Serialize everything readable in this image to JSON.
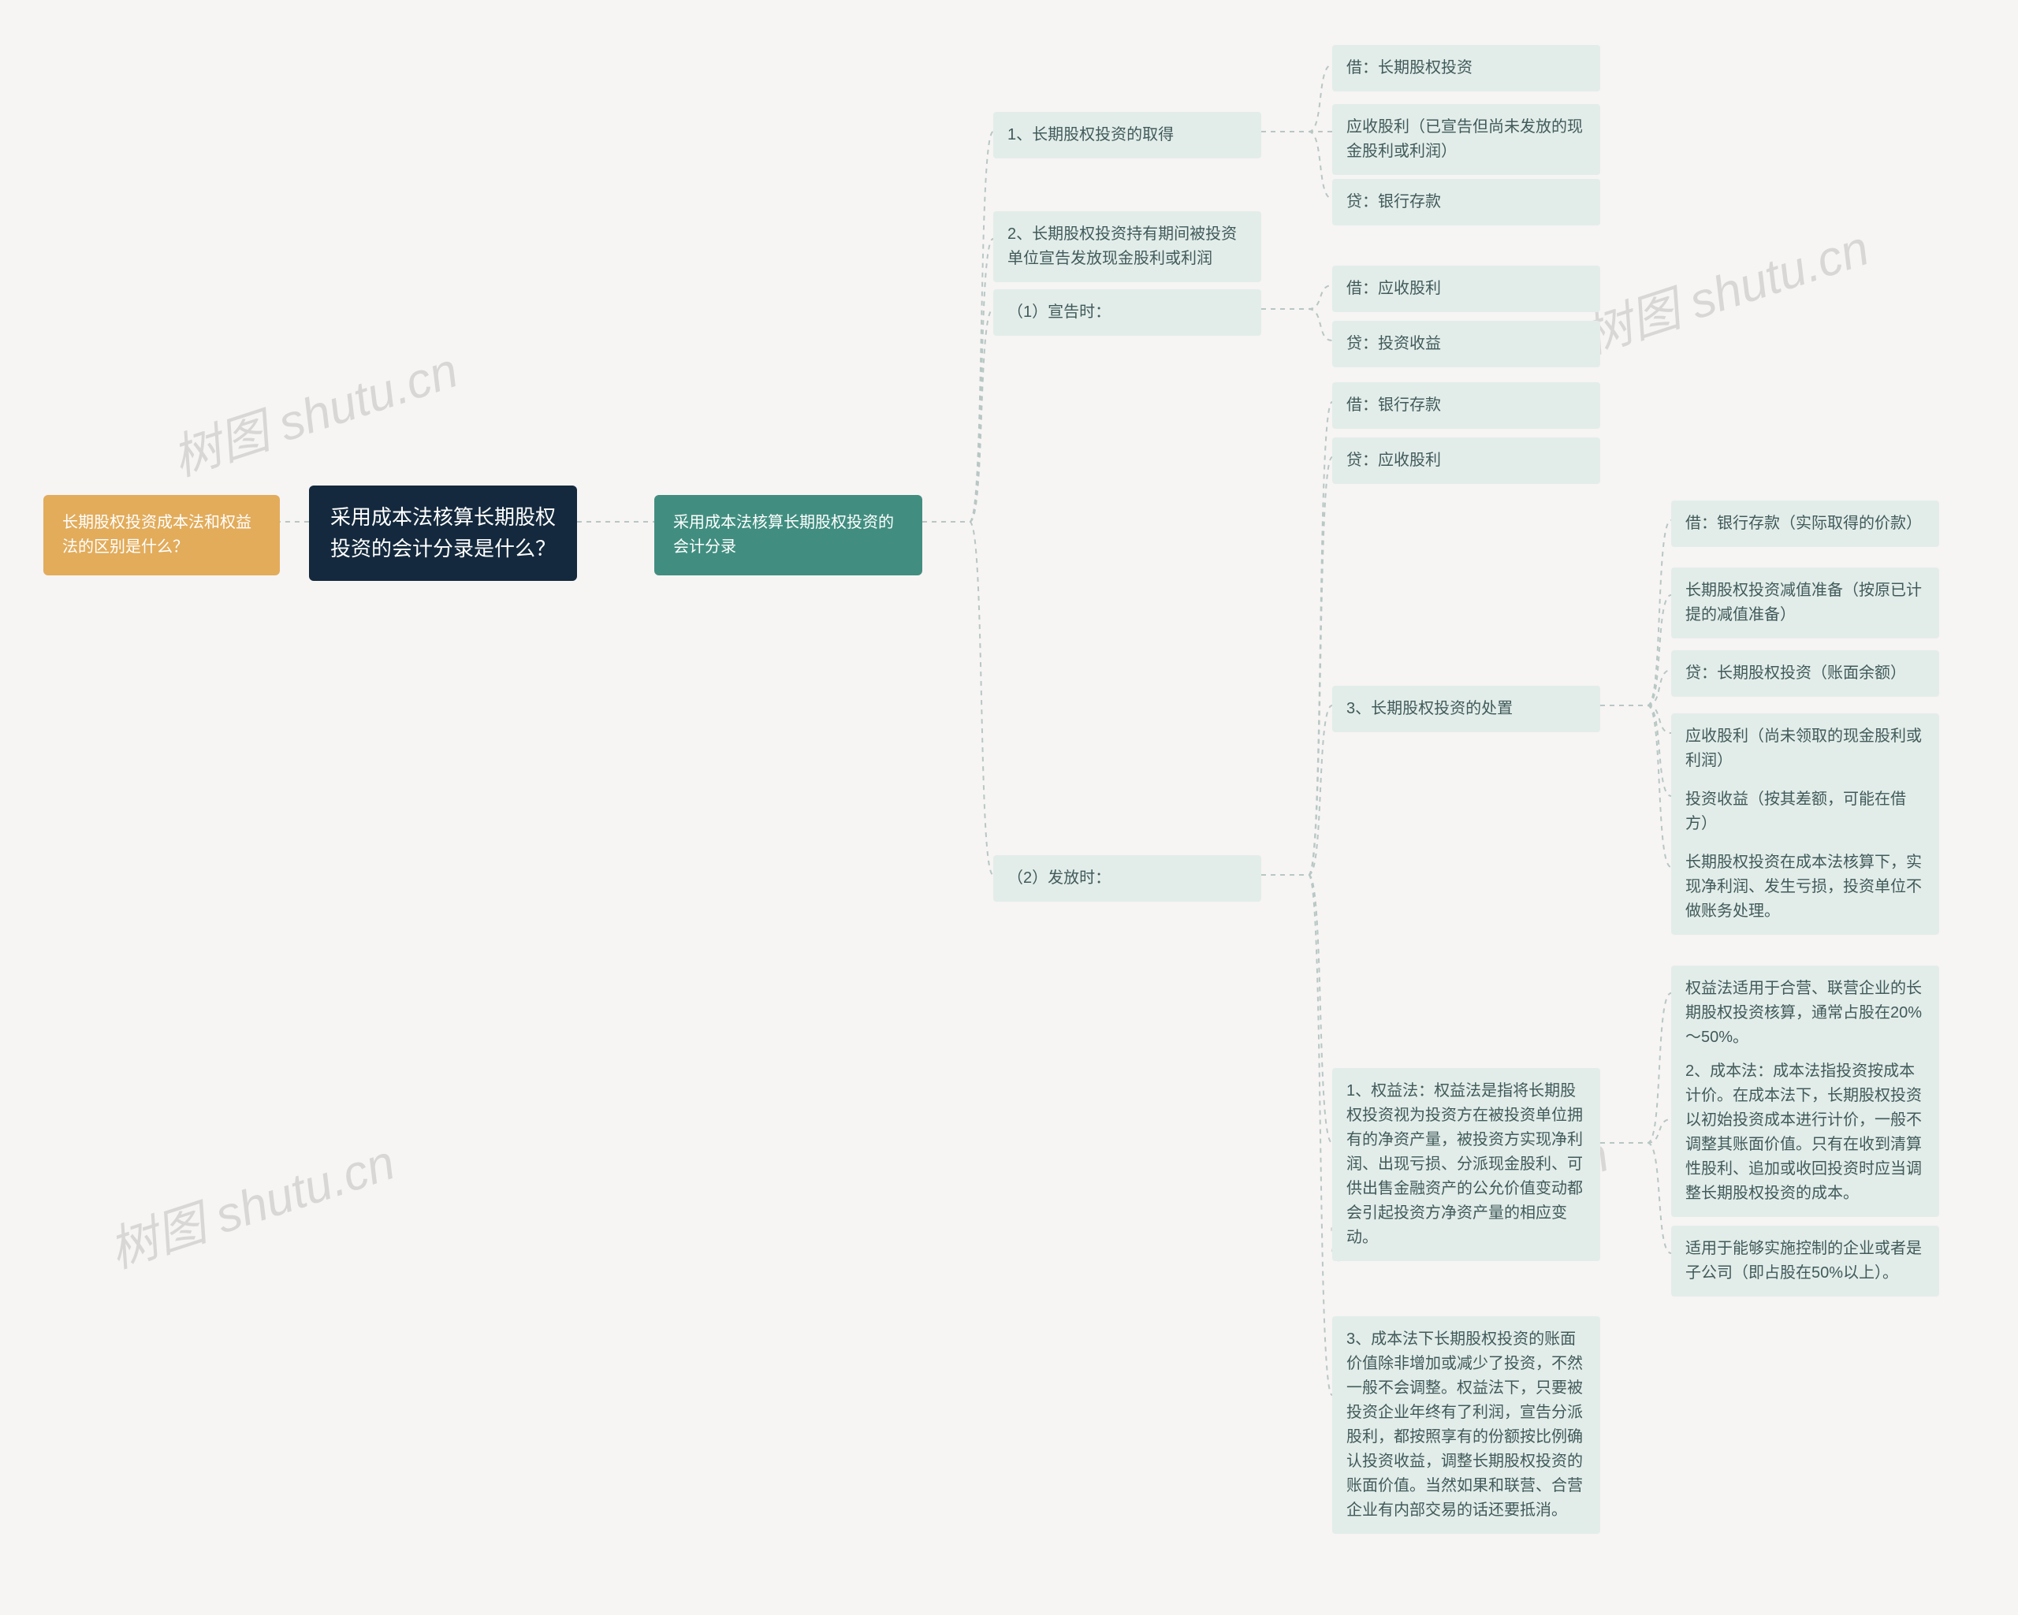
{
  "root": "采用成本法核算长期股权投资的会计分录是什么？",
  "left": {
    "q": "长期股权投资成本法和权益法的区别是什么？"
  },
  "right": {
    "title": "采用成本法核算长期股权投资的会计分录",
    "l1": {
      "n1": "1、长期股权投资的取得",
      "n1a": "借：长期股权投资",
      "n1b": "应收股利（已宣告但尚未发放的现金股利或利润）",
      "n1c": "贷：银行存款",
      "n2": "2、长期股权投资持有期间被投资单位宣告发放现金股利或利润",
      "n3": "（1）宣告时：",
      "n3a": "借：应收股利",
      "n3b": "贷：投资收益",
      "n4": "（2）发放时：",
      "n4a": "借：银行存款",
      "n4b": "贷：应收股利",
      "n5": "3、长期股权投资的处置",
      "n5a": "借：银行存款（实际取得的价款）",
      "n5b": "长期股权投资减值准备（按原已计提的减值准备）",
      "n5c": "贷：长期股权投资（账面余额）",
      "n5d": "应收股利（尚未领取的现金股利或利润）",
      "n5e": "投资收益（按其差额，可能在借方）",
      "n5f": "长期股权投资在成本法核算下，实现净利润、发生亏损，投资单位不做账务处理。",
      "n6": "1、权益法：权益法是指将长期股权投资视为投资方在被投资单位拥有的净资产量，被投资方实现净利润、出现亏损、分派现金股利、可供出售金融资产的公允价值变动都会引起投资方净资产量的相应变动。",
      "n6a": "权益法适用于合营、联营企业的长期股权投资核算，通常占股在20%～50%。",
      "n6b": "2、成本法：成本法指投资按成本计价。在成本法下，长期股权投资以初始投资成本进行计价，一般不调整其账面价值。只有在收到清算性股利、追加或收回投资时应当调整长期股权投资的成本。",
      "n6c": "适用于能够实施控制的企业或者是子公司（即占股在50%以上）。",
      "n7": "3、成本法下长期股权投资的账面价值除非增加或减少了投资，不然一般不会调整。权益法下，只要被投资企业年终有了利润，宣告分派股利，都按照享有的份额按比例确认投资收益，调整长期股权投资的账面价值。当然如果和联营、合营企业有内部交易的话还要抵消。"
    }
  },
  "watermark": "树图 shutu.cn"
}
